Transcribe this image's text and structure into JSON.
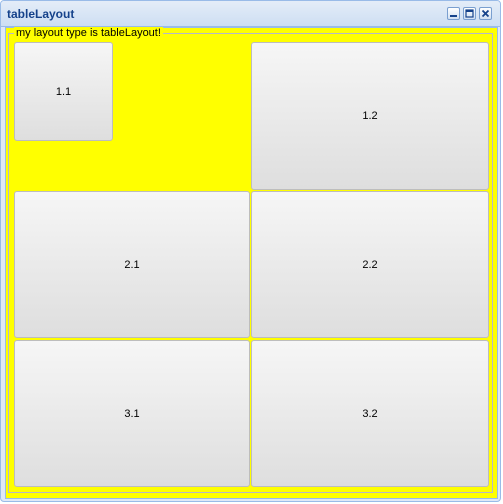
{
  "window": {
    "title": "tableLayout",
    "tools": [
      "minimize-icon",
      "maximize-icon",
      "close-icon"
    ]
  },
  "panel": {
    "legend": "my layout type is tableLayout!",
    "background_color": "#ffff00"
  },
  "buttons": {
    "b11": "1.1",
    "b12": "1.2",
    "b21": "2.1",
    "b22": "2.2",
    "b31": "3.1",
    "b32": "3.2"
  },
  "colors": {
    "title_text": "#15428b",
    "window_border": "#99bbe8"
  }
}
